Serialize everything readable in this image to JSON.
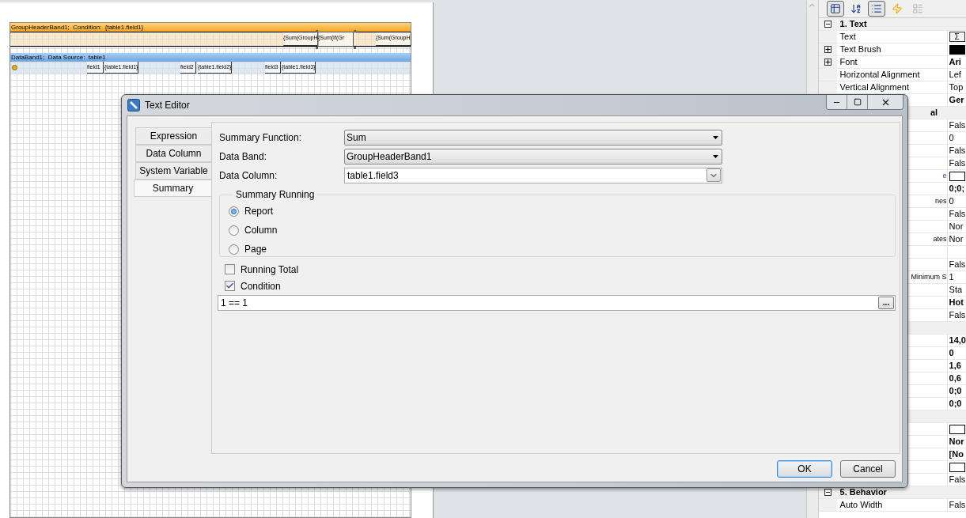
{
  "designer": {
    "bands": [
      {
        "kind": "group_header",
        "title": "GroupHeaderBand1;  Condition:  {table1.field1}",
        "components": [
          {
            "text": "{Sum(GroupH",
            "selected": false
          },
          {
            "text": "{Sum(If(Gr",
            "selected": true
          },
          {
            "text": "{Sum(GroupH",
            "selected": false
          }
        ]
      },
      {
        "kind": "data",
        "title": "DataBand1;  Data Source:  table1",
        "components": [
          {
            "text": "field1",
            "selected": false
          },
          {
            "text": "{table1.field1}",
            "selected": false
          },
          {
            "text": "field2",
            "selected": false
          },
          {
            "text": "{table1.field2}",
            "selected": false
          },
          {
            "text": "field3",
            "selected": false
          },
          {
            "text": "{table1.field3}",
            "selected": false
          }
        ]
      }
    ]
  },
  "property_grid": {
    "toolbar": [
      {
        "kind": "categorized",
        "selected": true,
        "disabled": false
      },
      {
        "kind": "alphabetical",
        "selected": false,
        "disabled": false
      },
      {
        "kind": "properties",
        "selected": true,
        "disabled": false
      },
      {
        "kind": "events",
        "selected": false,
        "disabled": false
      },
      {
        "kind": "pages",
        "selected": false,
        "disabled": true
      }
    ],
    "rows": [
      {
        "kind": "category",
        "label": "1. Text",
        "expanded": true
      },
      {
        "kind": "property",
        "label": "Text",
        "value": {
          "kind": "button",
          "text": "Σ"
        }
      },
      {
        "kind": "group_property",
        "label": "Text Brush",
        "expanded": false,
        "value": {
          "kind": "swatch",
          "color": "#000000"
        }
      },
      {
        "kind": "group_property",
        "label": "Font",
        "expanded": false,
        "value": {
          "kind": "bold",
          "text": "Ari"
        }
      },
      {
        "kind": "property",
        "label": "Horizontal Alignment",
        "value": {
          "kind": "text",
          "text": "Lef"
        }
      },
      {
        "kind": "property",
        "label": "Vertical Alignment",
        "value": {
          "kind": "text",
          "text": "Top"
        }
      },
      {
        "kind": "property",
        "value": {
          "kind": "bold",
          "text": "Ger"
        }
      },
      {
        "kind": "category",
        "fragment": "al"
      },
      {
        "kind": "property",
        "value": {
          "kind": "text",
          "text": "Fals"
        }
      },
      {
        "kind": "property",
        "value": {
          "kind": "text",
          "text": "0"
        }
      },
      {
        "kind": "property",
        "value": {
          "kind": "text",
          "text": "Fals"
        }
      },
      {
        "kind": "property",
        "value": {
          "kind": "text",
          "text": "Fals"
        }
      },
      {
        "kind": "property",
        "fragment": "e",
        "value": {
          "kind": "swatch",
          "color": "#ffffff"
        }
      },
      {
        "kind": "property",
        "value": {
          "kind": "bold",
          "text": "0;0;"
        }
      },
      {
        "kind": "property",
        "fragment": "nes",
        "value": {
          "kind": "text",
          "text": "0"
        }
      },
      {
        "kind": "property",
        "value": {
          "kind": "text",
          "text": "Fals"
        }
      },
      {
        "kind": "property",
        "value": {
          "kind": "text",
          "text": "Nor"
        }
      },
      {
        "kind": "property",
        "fragment": "ates",
        "value": {
          "kind": "text",
          "text": "Nor"
        }
      },
      {
        "kind": "property"
      },
      {
        "kind": "property",
        "value": {
          "kind": "text",
          "text": "Fals"
        }
      },
      {
        "kind": "property",
        "fragment": "Minimum S",
        "value": {
          "kind": "text",
          "text": "1"
        }
      },
      {
        "kind": "property",
        "value": {
          "kind": "text",
          "text": "Sta"
        }
      },
      {
        "kind": "property",
        "value": {
          "kind": "bold",
          "text": "Hot"
        }
      },
      {
        "kind": "property",
        "value": {
          "kind": "text",
          "text": "Fals"
        }
      },
      {
        "kind": "category"
      },
      {
        "kind": "property",
        "value": {
          "kind": "bold",
          "text": "14,0"
        }
      },
      {
        "kind": "property",
        "value": {
          "kind": "bold",
          "text": "0"
        }
      },
      {
        "kind": "property",
        "value": {
          "kind": "bold",
          "text": "1,6"
        }
      },
      {
        "kind": "property",
        "value": {
          "kind": "bold",
          "text": "0,6"
        }
      },
      {
        "kind": "property",
        "value": {
          "kind": "bold",
          "text": "0;0"
        }
      },
      {
        "kind": "property",
        "value": {
          "kind": "bold",
          "text": "0;0"
        }
      },
      {
        "kind": "category"
      },
      {
        "kind": "property",
        "value": {
          "kind": "swatch",
          "color": "#ffffff"
        }
      },
      {
        "kind": "property",
        "value": {
          "kind": "bold",
          "text": "Nor"
        }
      },
      {
        "kind": "property",
        "value": {
          "kind": "bold",
          "text": "[No"
        }
      },
      {
        "kind": "property",
        "value": {
          "kind": "swatch",
          "color": "#ffffff"
        }
      },
      {
        "kind": "property",
        "value": {
          "kind": "text",
          "text": "Fals"
        }
      },
      {
        "kind": "category",
        "label": "5. Behavior",
        "expanded": true
      },
      {
        "kind": "property",
        "label": "Auto Width",
        "value": {
          "kind": "text",
          "text": "Fals"
        }
      }
    ]
  },
  "dialog": {
    "title": "Text Editor",
    "tabs": [
      {
        "label": "Expression",
        "selected": false
      },
      {
        "label": "Data Column",
        "selected": false
      },
      {
        "label": "System Variable",
        "selected": false
      },
      {
        "label": "Summary",
        "selected": true
      }
    ],
    "fields": [
      {
        "kind": "combo",
        "label": "Summary Function:",
        "value": "Sum"
      },
      {
        "kind": "combo",
        "label": "Data Band:",
        "value": "GroupHeaderBand1"
      },
      {
        "kind": "editable_combo",
        "label": "Data Column:",
        "value": "table1.field3"
      }
    ],
    "summary_running": {
      "title": "Summary Running",
      "options": [
        {
          "label": "Report",
          "selected": true
        },
        {
          "label": "Column",
          "selected": false
        },
        {
          "label": "Page",
          "selected": false
        }
      ]
    },
    "checkboxes": [
      {
        "label": "Running Total",
        "checked": false
      },
      {
        "label": "Condition",
        "checked": true
      }
    ],
    "condition": {
      "value": "1 == 1",
      "button": "..."
    },
    "buttons": [
      {
        "label": "OK",
        "default": true
      },
      {
        "label": "Cancel",
        "default": false
      }
    ]
  }
}
